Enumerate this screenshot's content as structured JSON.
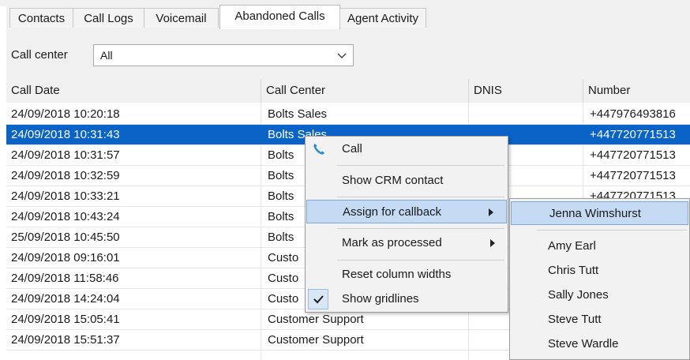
{
  "tabs": [
    "Contacts",
    "Call Logs",
    "Voicemail",
    "Abandoned Calls",
    "Agent Activity"
  ],
  "active_tab": "Abandoned Calls",
  "filter": {
    "label": "Call center",
    "value": "All"
  },
  "columns": [
    "Call Date",
    "Call Center",
    "DNIS",
    "Number"
  ],
  "rows": [
    {
      "date": "24/09/2018 10:20:18",
      "center": "Bolts Sales",
      "dnis": "",
      "number": "+447976493816"
    },
    {
      "date": "24/09/2018 10:31:43",
      "center": "Bolts Sales",
      "dnis": "",
      "number": "+447720771513"
    },
    {
      "date": "24/09/2018 10:31:57",
      "center": "Bolts",
      "dnis": "",
      "number": "+447720771513"
    },
    {
      "date": "24/09/2018 10:32:59",
      "center": "Bolts",
      "dnis": "",
      "number": "+447720771513"
    },
    {
      "date": "24/09/2018 10:33:21",
      "center": "Bolts",
      "dnis": "",
      "number": "+447720771513"
    },
    {
      "date": "24/09/2018 10:43:24",
      "center": "Bolts",
      "dnis": "",
      "number": ""
    },
    {
      "date": "25/09/2018 10:45:50",
      "center": "Bolts",
      "dnis": "",
      "number": ""
    },
    {
      "date": "24/09/2018 09:16:01",
      "center": "Custo",
      "dnis": "",
      "number": ""
    },
    {
      "date": "24/09/2018 11:58:46",
      "center": "Custo",
      "dnis": "",
      "number": ""
    },
    {
      "date": "24/09/2018 14:24:04",
      "center": "Custo",
      "dnis": "",
      "number": ""
    },
    {
      "date": "24/09/2018 15:05:41",
      "center": "Customer Support",
      "dnis": "",
      "number": ""
    },
    {
      "date": "24/09/2018 15:51:37",
      "center": "Customer Support",
      "dnis": "",
      "number": ""
    }
  ],
  "selected_row": 1,
  "context_menu": {
    "call": "Call",
    "show_crm": "Show CRM contact",
    "assign": "Assign for callback",
    "mark": "Mark as processed",
    "reset": "Reset column widths",
    "gridlines": "Show gridlines"
  },
  "submenu": [
    "Jenna Wimshurst",
    "Amy Earl",
    "Chris Tutt",
    "Sally Jones",
    "Steve Tutt",
    "Steve Wardle"
  ],
  "colors": {
    "selection": "#0a64c8",
    "menu_highlight": "#c5dbf3",
    "phone_icon": "#2a8ad4"
  },
  "icons": {
    "call": "phone-icon",
    "gridlines": "check-icon",
    "select": "chevron-down-icon",
    "submenu": "chevron-right-icon"
  }
}
